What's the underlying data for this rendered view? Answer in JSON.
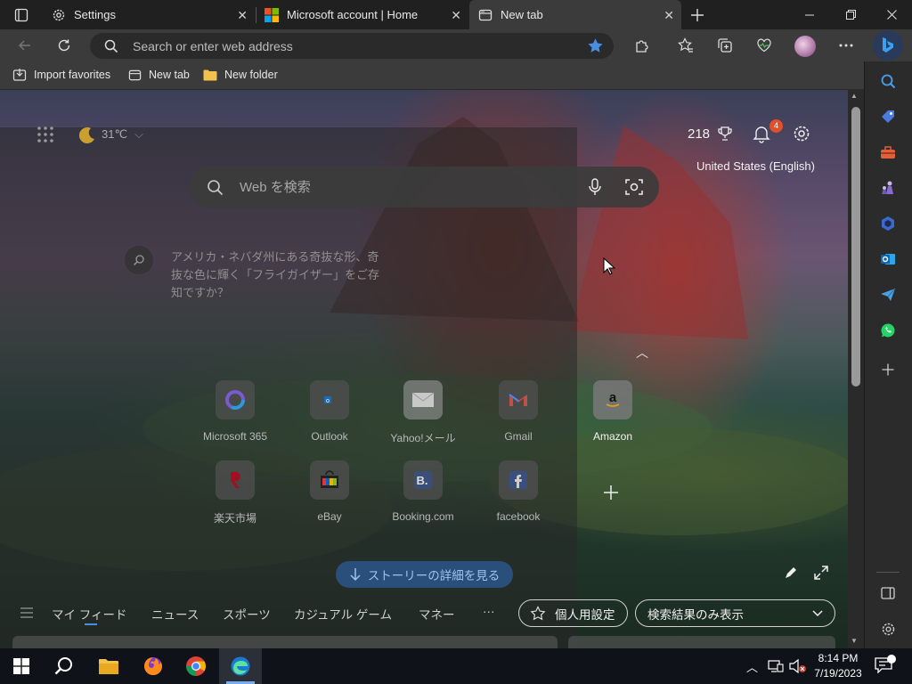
{
  "tabs": [
    {
      "title": "Settings",
      "icon": "gear-icon",
      "active": false
    },
    {
      "title": "Microsoft account | Home",
      "icon": "microsoft-logo-icon",
      "active": false
    },
    {
      "title": "New tab",
      "icon": "new-tab-icon",
      "active": true
    }
  ],
  "address_bar": {
    "placeholder": "Search or enter web address",
    "value": ""
  },
  "favorites": [
    {
      "label": "Import favorites",
      "icon": "import-icon"
    },
    {
      "label": "New tab",
      "icon": "new-tab-icon"
    },
    {
      "label": "New folder",
      "icon": "folder-icon"
    }
  ],
  "ntp": {
    "weather": "31℃",
    "points": "218",
    "notification_count": "4",
    "locale": "United States (English)",
    "search_placeholder": "Web を検索",
    "fact_text_line1": "アメリカ・ネバダ州にある奇抜な形、奇",
    "fact_text_line2": "抜な色に輝く「フライガイザー」をご存",
    "fact_text_line3": "知ですか？",
    "quick_links_row1": [
      "Microsoft 365",
      "Outlook",
      "Yahoo!メール",
      "Gmail",
      "Amazon"
    ],
    "quick_links_row2": [
      "楽天市場",
      "eBay",
      "Booking.com",
      "facebook"
    ],
    "story_button": "ストーリーの詳細を見る",
    "feed_tabs": [
      "マイ フィード",
      "ニュース",
      "スポーツ",
      "カジュアル ゲーム",
      "マネー"
    ],
    "more": "···",
    "personalize_label": "個人用設定",
    "view_select": "検索結果のみ表示"
  },
  "taskbar": {
    "time": "8:14 PM",
    "date": "7/19/2023",
    "apps": [
      "file-explorer-icon",
      "firefox-icon",
      "chrome-icon",
      "edge-icon"
    ]
  },
  "colors": {
    "accent": "#4a90e2",
    "badge": "#e0502a",
    "story_button_bg": "#2a4f7a"
  }
}
